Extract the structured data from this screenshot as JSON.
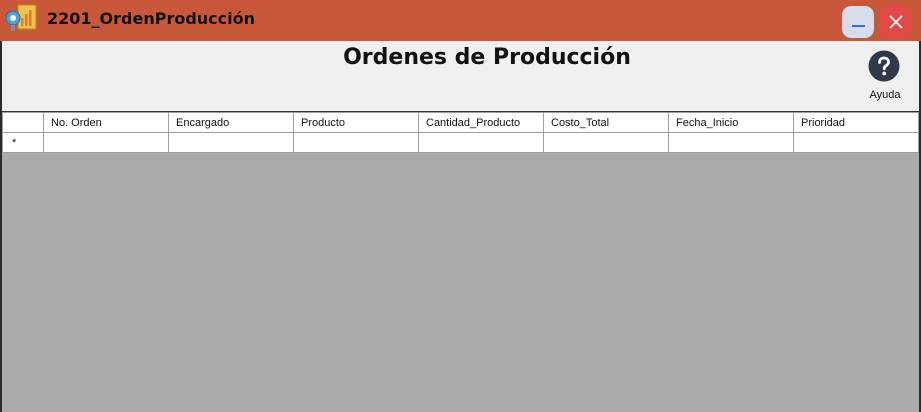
{
  "window": {
    "title": "2201_OrdenProducción",
    "minimize_label": "_",
    "close_label": "✕",
    "colors": {
      "titlebar": "#c9583a",
      "minimize_button": "#d7dced",
      "close_button": "#e24a4a",
      "grid_background": "#ababab"
    }
  },
  "header": {
    "title": "Ordenes de Producción",
    "help_label": "Ayuda",
    "help_icon": "question-circle-icon"
  },
  "grid": {
    "columns": [
      "No. Orden",
      "Encargado",
      "Producto",
      "Cantidad_Producto",
      "Costo_Total",
      "Fecha_Inicio",
      "Prioridad"
    ],
    "new_row_marker": "*",
    "rows": []
  }
}
